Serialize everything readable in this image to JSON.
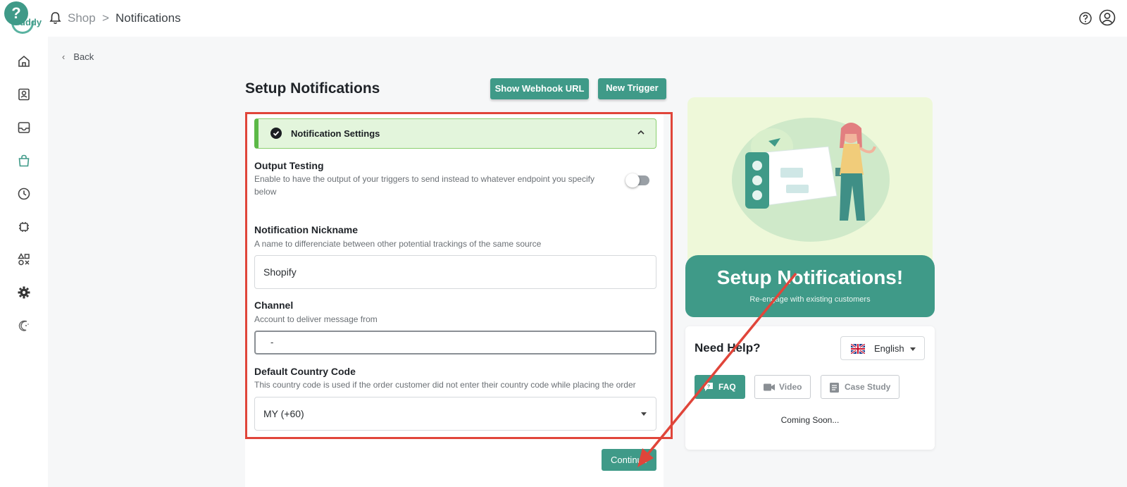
{
  "breadcrumb": {
    "shop": "Shop",
    "separator": ">",
    "current": "Notifications"
  },
  "logo": {
    "badge": "?",
    "text": "at uddy"
  },
  "back_label": "Back",
  "page_title": "Setup Notifications",
  "buttons": {
    "webhook": "Show Webhook URL",
    "new_trigger": "New Trigger",
    "continue": "Continue"
  },
  "section": {
    "label": "Notification Settings"
  },
  "output_testing": {
    "title": "Output Testing",
    "desc": "Enable to have the output of your triggers to send instead to whatever endpoint you specify below",
    "enabled": false
  },
  "nickname": {
    "title": "Notification Nickname",
    "desc": "A name to differenciate between other potential trackings of the same source",
    "value": "Shopify"
  },
  "channel": {
    "title": "Channel",
    "desc": "Account to deliver message from",
    "value": "-"
  },
  "country": {
    "title": "Default Country Code",
    "desc": "This country code is used if the order customer did not enter their country code while placing the order",
    "value": "MY (+60)"
  },
  "promo": {
    "title": "Setup Notifications!",
    "subtitle": "Re-engage with existing customers"
  },
  "help": {
    "title": "Need Help?",
    "language": "English",
    "tabs": {
      "faq": "FAQ",
      "video": "Video",
      "case_study": "Case Study"
    },
    "coming_soon": "Coming Soon..."
  },
  "colors": {
    "accent": "#3f9a88",
    "highlight": "#e0453a",
    "section_bg": "#e3f5dc"
  }
}
